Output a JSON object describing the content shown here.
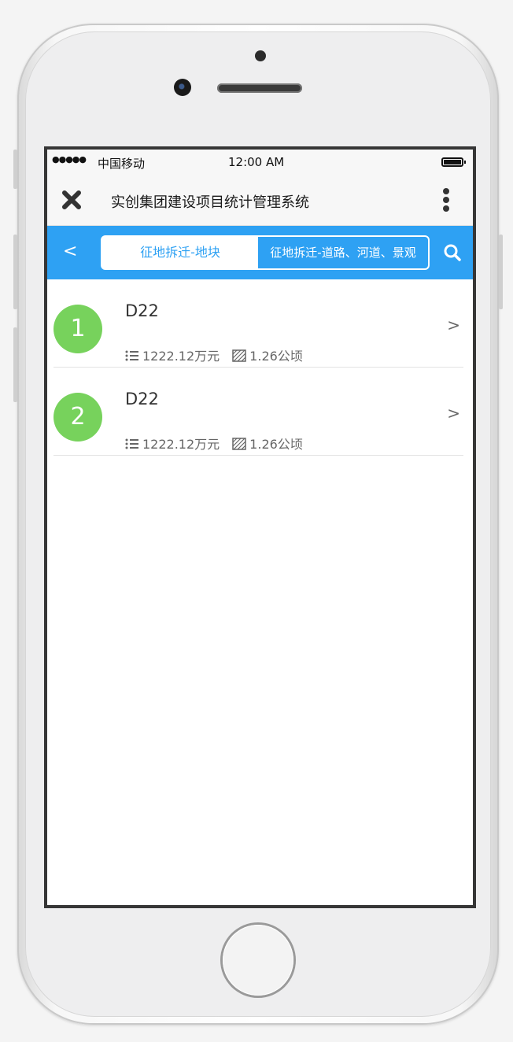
{
  "status_bar": {
    "signal": "●●●●●",
    "carrier": "中国移动",
    "time": "12:00 AM",
    "battery_icon": "battery-full-icon"
  },
  "header": {
    "close_icon": "close-icon",
    "title": "实创集团建设项目统计管理系统",
    "more_icon": "more-vertical-icon"
  },
  "tabbar": {
    "back_label": "<",
    "tabs": [
      {
        "label": "征地拆迁-地块",
        "active": false
      },
      {
        "label": "征地拆迁-道路、河道、景观",
        "active": true
      }
    ],
    "search_icon": "search-icon",
    "accent": "#2ea1f3"
  },
  "items": [
    {
      "index": "1",
      "name": "D22",
      "amount": "1222.12万元",
      "area": "1.26公顷",
      "chevron": ">"
    },
    {
      "index": "2",
      "name": "D22",
      "amount": "1222.12万元",
      "area": "1.26公顷",
      "chevron": ">"
    }
  ],
  "colors": {
    "badge": "#77d25c",
    "primary": "#2ea1f3"
  }
}
